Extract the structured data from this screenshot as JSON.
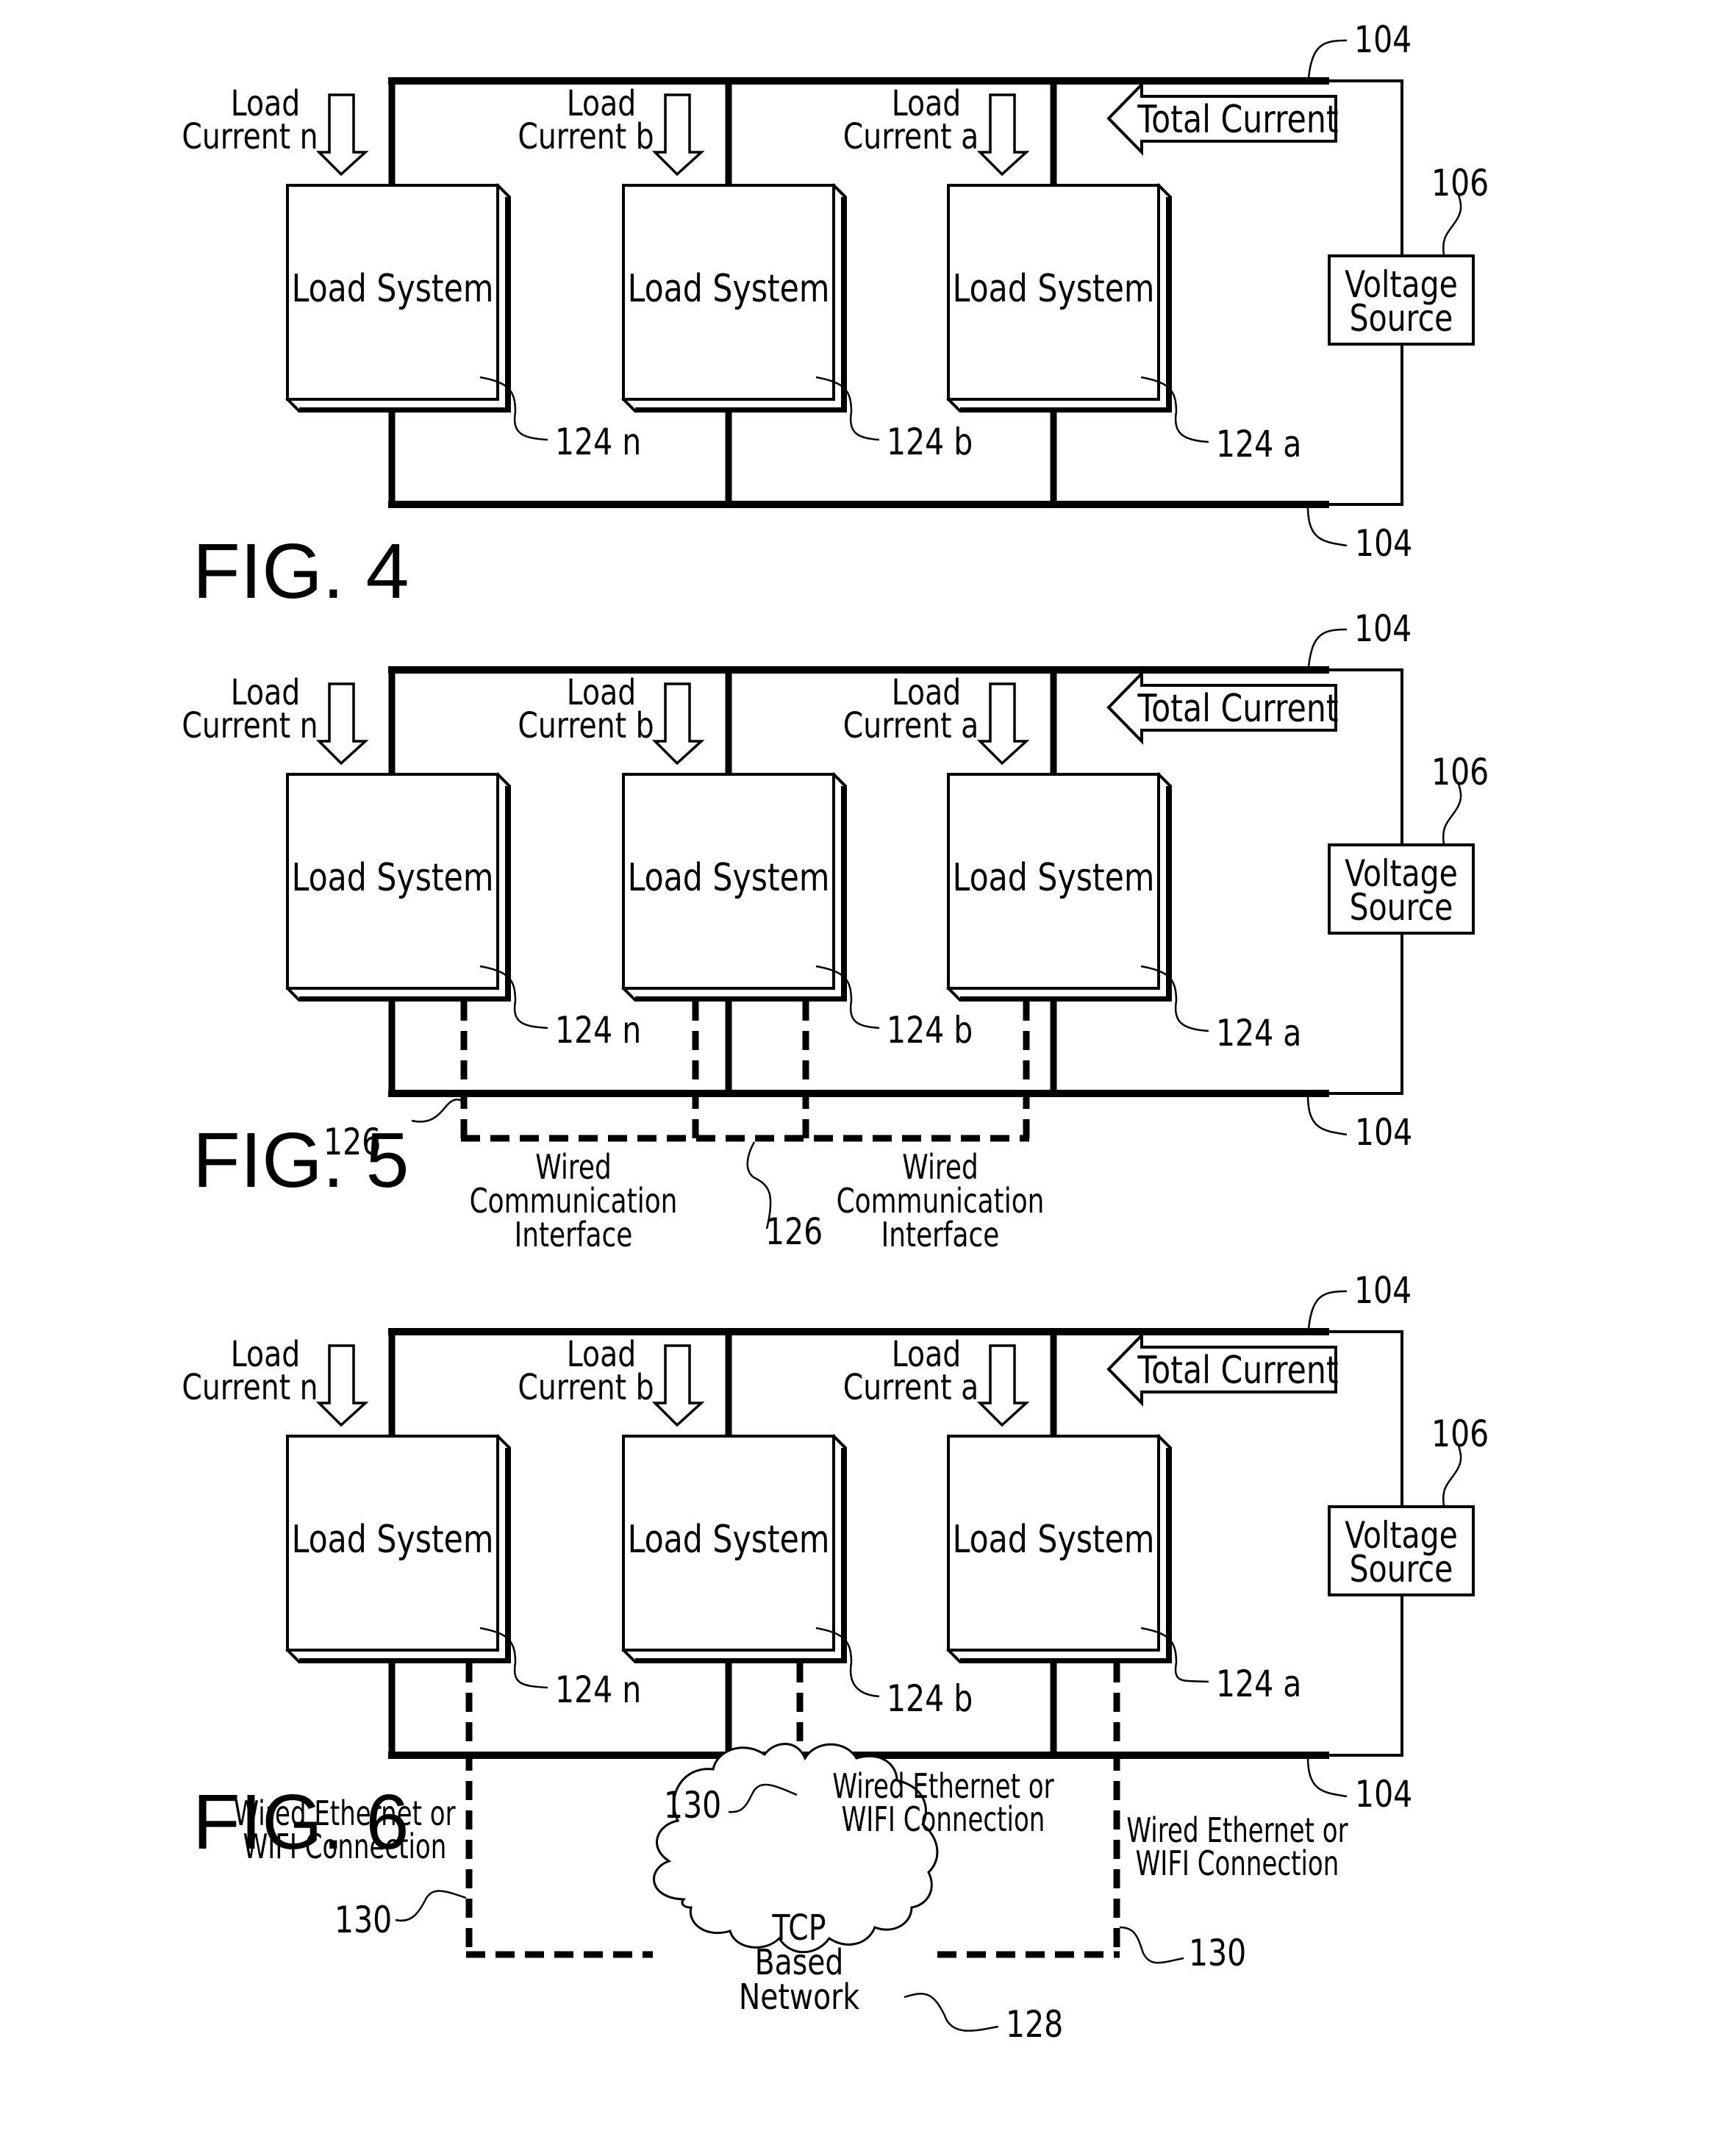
{
  "page": {
    "background": "#ffffff",
    "ink": "#000000"
  },
  "figures": [
    {
      "id": "fig4",
      "title": "FIG. 4",
      "rail_ref": "104",
      "total_current_label": "Total Current",
      "voltage_source": {
        "line1": "Voltage",
        "line2": "Source",
        "ref": "106"
      },
      "load_systems": [
        {
          "label": "Load System",
          "ref": "124 n",
          "current_line1": "Load",
          "current_line2": "Current n"
        },
        {
          "label": "Load System",
          "ref": "124 b",
          "current_line1": "Load",
          "current_line2": "Current b"
        },
        {
          "label": "Load System",
          "ref": "124 a",
          "current_line1": "Load",
          "current_line2": "Current a"
        }
      ],
      "connections": null
    },
    {
      "id": "fig5",
      "title": "FIG. 5",
      "rail_ref": "104",
      "total_current_label": "Total Current",
      "voltage_source": {
        "line1": "Voltage",
        "line2": "Source",
        "ref": "106"
      },
      "load_systems": [
        {
          "label": "Load System",
          "ref": "124 n",
          "current_line1": "Load",
          "current_line2": "Current n"
        },
        {
          "label": "Load System",
          "ref": "124 b",
          "current_line1": "Load",
          "current_line2": "Current b"
        },
        {
          "label": "Load System",
          "ref": "124 a",
          "current_line1": "Load",
          "current_line2": "Current a"
        }
      ],
      "connections": {
        "type": "wired",
        "ref": "126",
        "labels": [
          [
            "Wired",
            "Communication",
            "Interface"
          ],
          [
            "Wired",
            "Communication",
            "Interface"
          ]
        ]
      }
    },
    {
      "id": "fig6",
      "title": "FIG. 6",
      "rail_ref": "104",
      "total_current_label": "Total Current",
      "voltage_source": {
        "line1": "Voltage",
        "line2": "Source",
        "ref": "106"
      },
      "load_systems": [
        {
          "label": "Load System",
          "ref": "124 n",
          "current_line1": "Load",
          "current_line2": "Current n"
        },
        {
          "label": "Load System",
          "ref": "124 b",
          "current_line1": "Load",
          "current_line2": "Current b"
        },
        {
          "label": "Load System",
          "ref": "124 a",
          "current_line1": "Load",
          "current_line2": "Current a"
        }
      ],
      "connections": {
        "type": "network",
        "ref": "130",
        "network": {
          "line1": "TCP",
          "line2": "Based",
          "line3": "Network",
          "ref": "128"
        },
        "labels": [
          [
            "Wired Ethernet or",
            "WIFI Connection"
          ],
          [
            "Wired Ethernet or",
            "WIFI Connection"
          ],
          [
            "Wired Ethernet or",
            "WIFI Connection"
          ]
        ]
      }
    }
  ]
}
